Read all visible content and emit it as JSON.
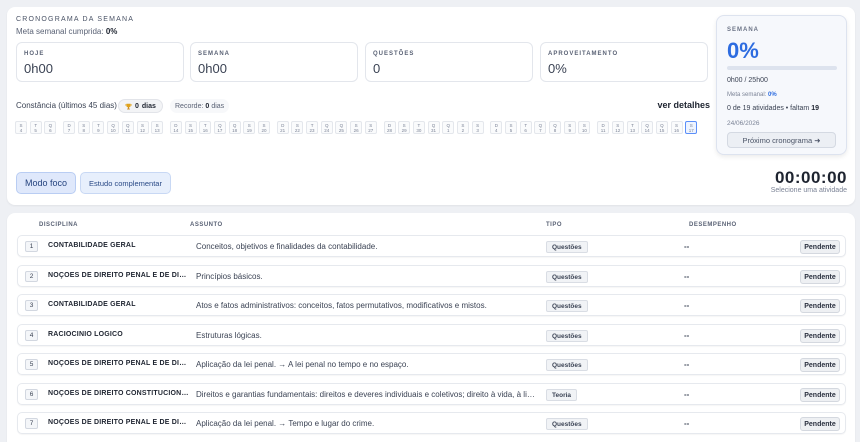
{
  "header": {
    "title": "CRONOGRAMA DA SEMANA",
    "meta_label": "Meta semanal cumprida:",
    "meta_value": "0%"
  },
  "stats": [
    {
      "label": "HOJE",
      "value": "0h00"
    },
    {
      "label": "SEMANA",
      "value": "0h00"
    },
    {
      "label": "QUESTÕES",
      "value": "0"
    },
    {
      "label": "APROVEITAMENTO",
      "value": "0%"
    }
  ],
  "constancy": {
    "label": "Constância (últimos 45 dias)",
    "streak_value": "0",
    "streak_unit": "dias",
    "record_label": "Recorde:",
    "record_value": "0",
    "record_unit": "dias",
    "details_link": "ver detalhes"
  },
  "calendar": {
    "days": [
      {
        "w": "S",
        "d": "4"
      },
      {
        "w": "T",
        "d": "5"
      },
      {
        "w": "Q",
        "d": "6"
      },
      {
        "w": "D",
        "d": "7"
      },
      {
        "w": "S",
        "d": "8"
      },
      {
        "w": "T",
        "d": "9"
      },
      {
        "w": "Q",
        "d": "10"
      },
      {
        "w": "Q",
        "d": "11"
      },
      {
        "w": "S",
        "d": "12"
      },
      {
        "w": "S",
        "d": "13"
      },
      {
        "w": "D",
        "d": "14"
      },
      {
        "w": "S",
        "d": "15"
      },
      {
        "w": "T",
        "d": "16"
      },
      {
        "w": "Q",
        "d": "17"
      },
      {
        "w": "Q",
        "d": "18"
      },
      {
        "w": "S",
        "d": "19"
      },
      {
        "w": "S",
        "d": "20"
      },
      {
        "w": "D",
        "d": "21"
      },
      {
        "w": "S",
        "d": "22"
      },
      {
        "w": "T",
        "d": "23"
      },
      {
        "w": "Q",
        "d": "24"
      },
      {
        "w": "Q",
        "d": "25"
      },
      {
        "w": "S",
        "d": "26"
      },
      {
        "w": "S",
        "d": "27"
      },
      {
        "w": "D",
        "d": "28"
      },
      {
        "w": "S",
        "d": "29"
      },
      {
        "w": "T",
        "d": "30"
      },
      {
        "w": "Q",
        "d": "31"
      },
      {
        "w": "Q",
        "d": "1"
      },
      {
        "w": "S",
        "d": "2"
      },
      {
        "w": "S",
        "d": "3"
      },
      {
        "w": "D",
        "d": "4"
      },
      {
        "w": "S",
        "d": "5"
      },
      {
        "w": "T",
        "d": "6"
      },
      {
        "w": "Q",
        "d": "7"
      },
      {
        "w": "Q",
        "d": "8"
      },
      {
        "w": "S",
        "d": "9"
      },
      {
        "w": "S",
        "d": "10"
      },
      {
        "w": "D",
        "d": "11"
      },
      {
        "w": "S",
        "d": "12"
      },
      {
        "w": "T",
        "d": "13"
      },
      {
        "w": "Q",
        "d": "14"
      },
      {
        "w": "Q",
        "d": "15"
      },
      {
        "w": "S",
        "d": "16"
      },
      {
        "w": "S",
        "d": "17"
      }
    ],
    "week_starts": [
      3,
      10,
      17,
      24,
      31,
      38
    ]
  },
  "actions": {
    "focus_mode": "Modo foco",
    "extra_study": "Estudo complementar"
  },
  "timer": {
    "value": "00:00:00",
    "hint": "Selecione uma atividade"
  },
  "week_card": {
    "label": "SEMANA",
    "percent": "0%",
    "progress": 0,
    "hours": "0h00 / 25h00",
    "meta_label": "Meta semanal:",
    "meta_value": "0%",
    "activities_done": "0",
    "activities_text": "de 19 atividades • faltam",
    "activities_left": "19",
    "date": "24/06/2026",
    "next_button": "Próximo cronograma ➜"
  },
  "table": {
    "headers": {
      "disciplina": "DISCIPLINA",
      "assunto": "ASSUNTO",
      "tipo": "TIPO",
      "desempenho": "DESEMPENHO"
    },
    "rows": [
      {
        "n": "1",
        "disciplina": "CONTABILIDADE GERAL",
        "assunto": "Conceitos, objetivos e finalidades da contabilidade.",
        "tipo": "Questões",
        "desempenho": "--",
        "status": "Pendente"
      },
      {
        "n": "2",
        "disciplina": "NOÇÕES DE DIREITO PENAL E DE DIREITO PROCESSUAL PENAL",
        "assunto": "Princípios básicos.",
        "tipo": "Questões",
        "desempenho": "--",
        "status": "Pendente"
      },
      {
        "n": "3",
        "disciplina": "CONTABILIDADE GERAL",
        "assunto": "Atos e fatos administrativos: conceitos, fatos permutativos, modificativos e mistos.",
        "tipo": "Questões",
        "desempenho": "--",
        "status": "Pendente"
      },
      {
        "n": "4",
        "disciplina": "RACIOCÍNIO LÓGICO",
        "assunto": "Estruturas lógicas.",
        "tipo": "Questões",
        "desempenho": "--",
        "status": "Pendente"
      },
      {
        "n": "5",
        "disciplina": "NOÇÕES DE DIREITO PENAL E DE DIREITO PROCESSUAL PENAL",
        "assunto": "Aplicação da lei penal. → A lei penal no tempo e no espaço.",
        "tipo": "Questões",
        "desempenho": "--",
        "status": "Pendente"
      },
      {
        "n": "6",
        "disciplina": "NOÇÕES DE DIREITO CONSTITUCIONAL",
        "assunto": "Direitos e garantias fundamentais: direitos e deveres individuais e coletivos; direito à vida, à liberdade, à igualdade",
        "tipo": "Teoria",
        "desempenho": "--",
        "status": "Pendente"
      },
      {
        "n": "7",
        "disciplina": "NOÇÕES DE DIREITO PENAL E DE DIREITO PROCESSUAL PENAL",
        "assunto": "Aplicação da lei penal. → Tempo e lugar do crime.",
        "tipo": "Questões",
        "desempenho": "--",
        "status": "Pendente"
      }
    ]
  }
}
